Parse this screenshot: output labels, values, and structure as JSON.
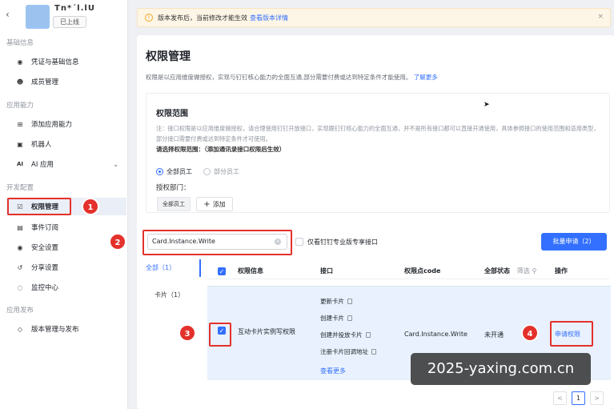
{
  "app": {
    "name": "Tn*´l.lU",
    "status": "已上线",
    "logo_color": "#9cc3f0"
  },
  "sidebar": {
    "groups": {
      "basic": "基础信息",
      "capability": "应用能力",
      "dev": "开发配置",
      "release": "应用发布"
    },
    "items": [
      {
        "label": "凭证与基础信息",
        "icon": "key-icon"
      },
      {
        "label": "成员管理",
        "icon": "user-icon"
      },
      {
        "label": "添加应用能力",
        "icon": "grid-icon"
      },
      {
        "label": "机器人",
        "icon": "robot-icon"
      },
      {
        "label": "AI 应用",
        "icon": "ai-icon"
      },
      {
        "label": "权限管理",
        "icon": "permission-icon"
      },
      {
        "label": "事件订阅",
        "icon": "event-icon"
      },
      {
        "label": "安全设置",
        "icon": "shield-icon"
      },
      {
        "label": "分享设置",
        "icon": "share-icon"
      },
      {
        "label": "监控中心",
        "icon": "monitor-icon"
      },
      {
        "label": "版本管理与发布",
        "icon": "version-icon"
      }
    ],
    "active_item": "权限管理",
    "ai_prefix": "AI"
  },
  "notice": {
    "text": "版本发布后，当前修改才能生效",
    "link": "查看版本详情",
    "close_symbol": "×"
  },
  "page": {
    "title": "权限管理",
    "description": "权限是以应用维度做授权，实现与钉钉核心能力的全面互通,部分需要付费或达到特定条件才能使用。",
    "learn_more": "了解更多"
  },
  "scope": {
    "title": "权限范围",
    "note": "注：接口权限是以应用维度做授权，请合理使用钉钉开放接口，实现跟钉钉核心能力的全面互通，并不是所有接口都可以直接开通使用，具体参照接口的使用范围和适用类型，部分接口需要付费或达到特定条件才可使用。",
    "select_label": "请选择权限范围：（添加通讯录接口权限后生效）",
    "options": [
      "全部员工",
      "部分员工"
    ],
    "selected": "全部员工",
    "auth_dept_label": "授权部门：",
    "dept_tag": "全部员工",
    "add_label": "添加",
    "add_symbol": "+"
  },
  "toolbar": {
    "search_value": "Card.Instance.Write",
    "pro_only_label": "仅看钉钉专业版专享接口",
    "batch_apply": "批量申请（2）"
  },
  "filters": [
    {
      "label": "全部（1）",
      "active": true
    },
    {
      "label": "卡片（1）",
      "active": false
    }
  ],
  "table": {
    "headers": {
      "info": "权限信息",
      "api": "接口",
      "code": "权限点code",
      "status": "全部状态",
      "filter": "筛选",
      "action": "操作"
    },
    "rows": [
      {
        "name": "互动卡片实例写权限",
        "apis": [
          "更新卡片",
          "创建卡片",
          "创建并投放卡片",
          "注册卡片回调地址"
        ],
        "view_more": "查看更多",
        "code": "Card.Instance.Write",
        "status": "未开通",
        "action": "申请权限",
        "checked": true
      }
    ]
  },
  "pagination": {
    "prev": "<",
    "current": "1",
    "next": ">"
  },
  "annotations": [
    "1",
    "2",
    "3",
    "4"
  ],
  "watermark": "2025-yaxing.com.cn",
  "colors": {
    "accent": "#3370ff",
    "highlight": "#e4312b",
    "row_selected": "#e8f1fd",
    "notice_bg": "#fdf5e6"
  }
}
